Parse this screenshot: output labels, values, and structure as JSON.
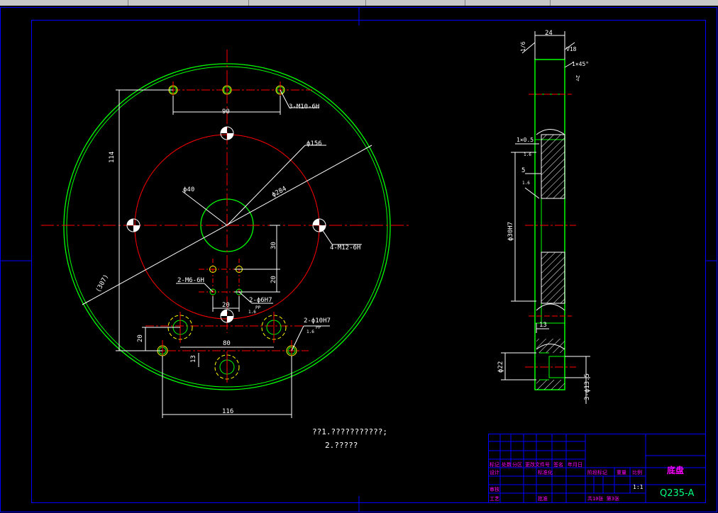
{
  "window": {
    "top_toolbar": "window-toolbar-strip"
  },
  "colors": {
    "background": "#000000",
    "border": "#0000ff",
    "outline": "#00ff00",
    "centerline": "#ff0000",
    "hole": "#ffff00",
    "dimension": "#ffffff",
    "title_text": "#ff00ff"
  },
  "front_view": {
    "dims": {
      "top_holes_spacing": "90",
      "top_thread": "3-M10-6H",
      "vertical_114": "114",
      "pcd_156": "ϕ156",
      "pcd_284": "ϕ284",
      "bore_40": "ϕ40",
      "side_thread": "4-M12-6H",
      "d30": "30",
      "d20_right": "20",
      "m6": "2-M6-6H",
      "pin_hole": "2-ϕ6H7",
      "pin_pp": "PP",
      "d20_bottom": "20",
      "diameter_307": "(307)",
      "d20_left": "20",
      "d80": "80",
      "d13": "13",
      "pin_10": "2-ϕ10H7",
      "pp2": "PP",
      "d116": "116",
      "ra16a": "1.6",
      "ra16b": "1.6"
    }
  },
  "side_view": {
    "dims": {
      "thickness_24": "24",
      "chamfer_top": "1×45°",
      "r_top": "∇18",
      "face_finish": "1/6",
      "chamfer_1x05": "1×0.5",
      "ra_16": "1.6",
      "d5": "5",
      "ra_16b": "1.6",
      "bore_30": "ϕ30H7",
      "d13": "13",
      "d22": "ϕ22",
      "counterbore": "3-ϕ13.5",
      "small_22": "2▽"
    }
  },
  "notes": {
    "line1": "??1.???????????;",
    "line2": "2.?????"
  },
  "title_block": {
    "part_name": "底盘",
    "material": "Q235-A",
    "scale": "1:1",
    "row_labels": [
      "标记",
      "处数",
      "分区",
      "更改文件号",
      "签名",
      "年月日"
    ],
    "designer": "设计",
    "standard": "标准化",
    "review": "审核",
    "process": "工艺",
    "approve": "批准",
    "stage_mark": "阶段标记",
    "weight": "重量",
    "scale_label": "比例",
    "sheets": "共10张 第3张"
  }
}
